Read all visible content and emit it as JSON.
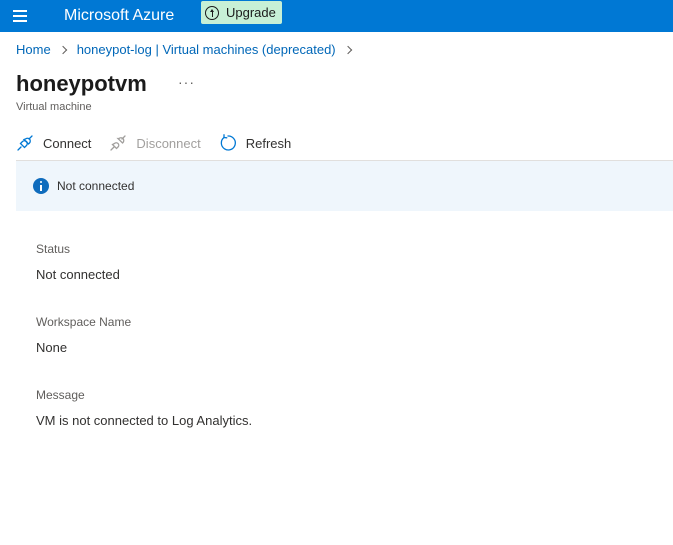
{
  "topbar": {
    "brand": "Microsoft Azure",
    "upgrade_label": "Upgrade",
    "accent": "#0078d4"
  },
  "breadcrumb": [
    {
      "label": "Home"
    },
    {
      "label": "honeypot-log | Virtual machines (deprecated)"
    }
  ],
  "header": {
    "title": "honeypotvm",
    "more": "···",
    "subtitle": "Virtual machine"
  },
  "toolbar": {
    "connect_label": "Connect",
    "disconnect_label": "Disconnect",
    "refresh_label": "Refresh"
  },
  "banner": {
    "text": "Not connected",
    "icon": "info-icon"
  },
  "details": {
    "status_label": "Status",
    "status_value": "Not connected",
    "workspace_label": "Workspace Name",
    "workspace_value": "None",
    "message_label": "Message",
    "message_value": "VM is not connected to Log Analytics."
  }
}
